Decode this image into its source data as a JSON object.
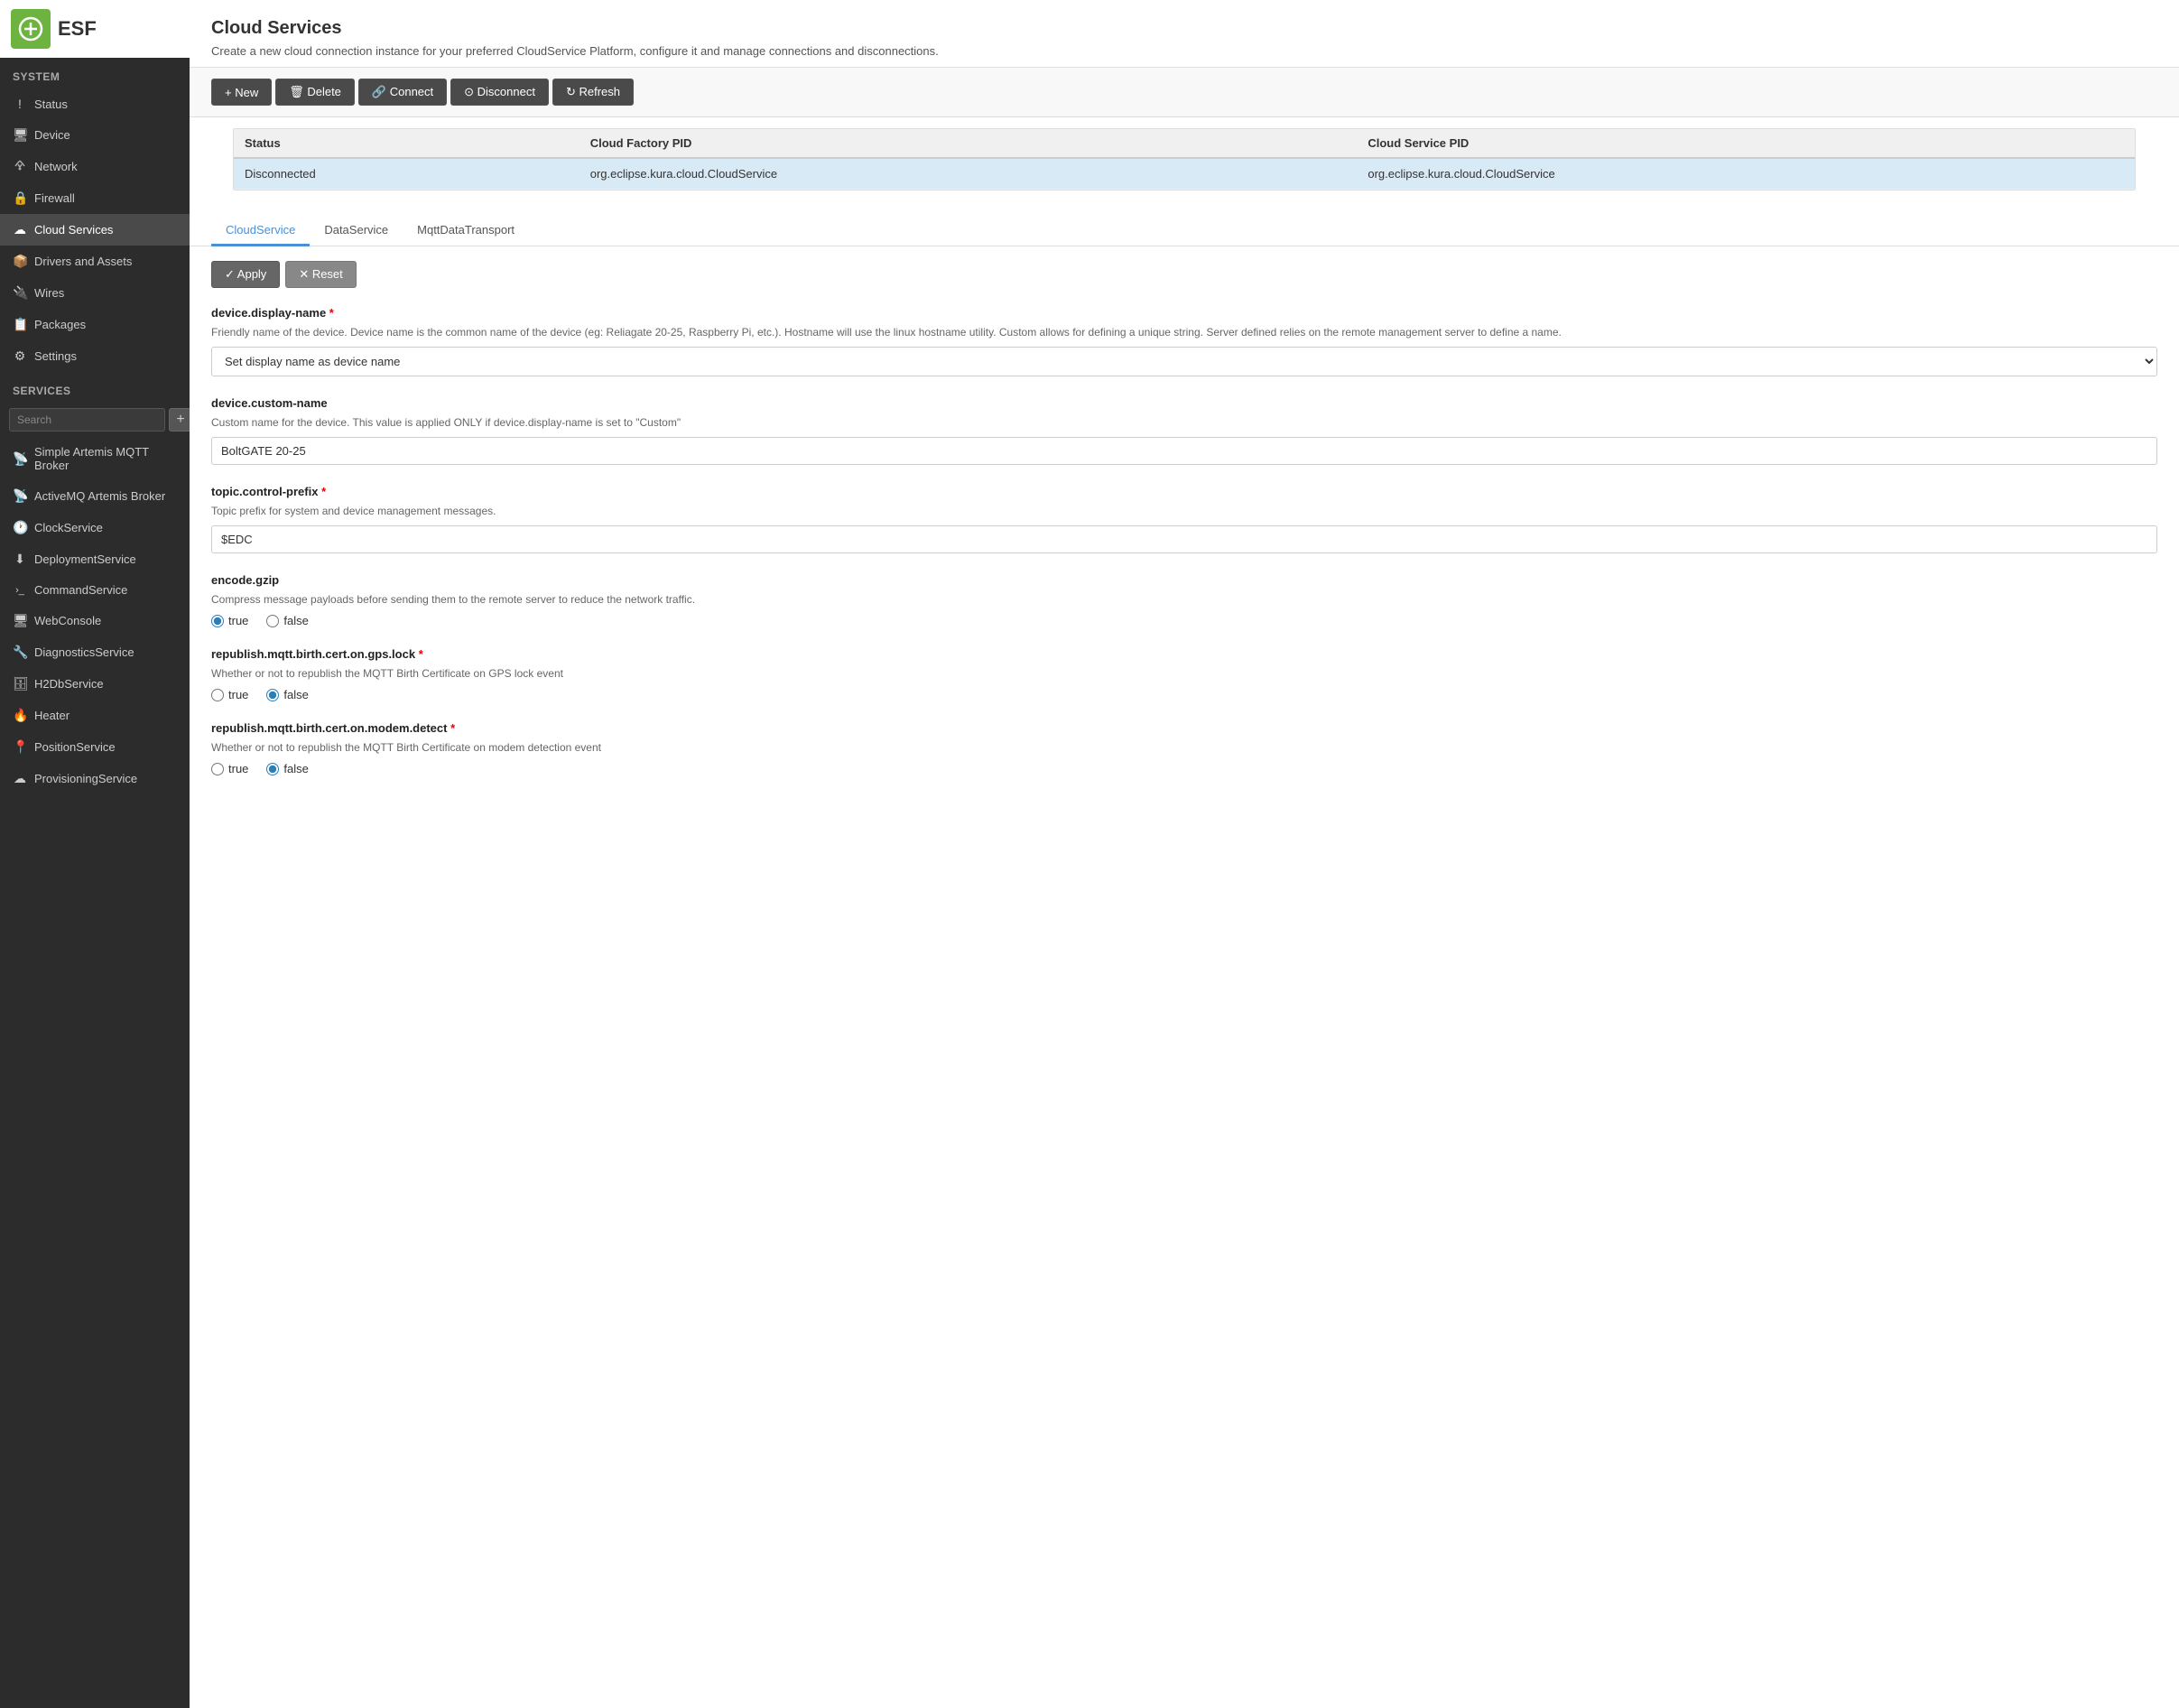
{
  "logo": {
    "text": "ESF"
  },
  "sidebar": {
    "system_section": "System",
    "system_items": [
      {
        "id": "status",
        "label": "Status",
        "icon": "!"
      },
      {
        "id": "device",
        "label": "Device",
        "icon": "🖥"
      },
      {
        "id": "network",
        "label": "Network",
        "icon": "📶"
      },
      {
        "id": "firewall",
        "label": "Firewall",
        "icon": "🔒"
      },
      {
        "id": "cloud-services",
        "label": "Cloud Services",
        "icon": "☁"
      },
      {
        "id": "drivers-assets",
        "label": "Drivers and Assets",
        "icon": "📦"
      },
      {
        "id": "wires",
        "label": "Wires",
        "icon": "🔌"
      },
      {
        "id": "packages",
        "label": "Packages",
        "icon": "📋"
      },
      {
        "id": "settings",
        "label": "Settings",
        "icon": "⚙"
      }
    ],
    "services_section": "Services",
    "services_search_placeholder": "Search",
    "services_add_label": "+",
    "services_items": [
      {
        "id": "simple-artemis",
        "label": "Simple Artemis MQTT Broker",
        "icon": "📡"
      },
      {
        "id": "activemq-artemis",
        "label": "ActiveMQ Artemis Broker",
        "icon": "📡"
      },
      {
        "id": "clockservice",
        "label": "ClockService",
        "icon": "🕐"
      },
      {
        "id": "deploymentservice",
        "label": "DeploymentService",
        "icon": "⬇"
      },
      {
        "id": "commandservice",
        "label": "CommandService",
        "icon": ">_"
      },
      {
        "id": "webconsole",
        "label": "WebConsole",
        "icon": "🖥"
      },
      {
        "id": "diagnosticsservice",
        "label": "DiagnosticsService",
        "icon": "🔧"
      },
      {
        "id": "h2dbservice",
        "label": "H2DbService",
        "icon": "🗄"
      },
      {
        "id": "heater",
        "label": "Heater",
        "icon": "🔥"
      },
      {
        "id": "positionservice",
        "label": "PositionService",
        "icon": "📍"
      },
      {
        "id": "provisioningservice",
        "label": "ProvisioningService",
        "icon": "☁"
      }
    ]
  },
  "page": {
    "title": "Cloud Services",
    "subtitle": "Create a new cloud connection instance for your preferred CloudService Platform, configure it and manage connections and disconnections."
  },
  "toolbar": {
    "new_label": "+ New",
    "delete_label": "🗑 Delete",
    "connect_label": "🔗 Connect",
    "disconnect_label": "⊙ Disconnect",
    "refresh_label": "↻ Refresh"
  },
  "table": {
    "columns": [
      "Status",
      "Cloud Factory PID",
      "Cloud Service PID"
    ],
    "rows": [
      {
        "status": "Disconnected",
        "factory_pid": "org.eclipse.kura.cloud.CloudService",
        "service_pid": "org.eclipse.kura.cloud.CloudService",
        "selected": true
      }
    ]
  },
  "tabs": [
    {
      "id": "cloudservice",
      "label": "CloudService",
      "active": true
    },
    {
      "id": "dataservice",
      "label": "DataService",
      "active": false
    },
    {
      "id": "mqttdatatransport",
      "label": "MqttDataTransport",
      "active": false
    }
  ],
  "config": {
    "apply_label": "✓ Apply",
    "reset_label": "✕ Reset",
    "fields": [
      {
        "id": "device-display-name",
        "label": "device.display-name",
        "required": true,
        "description": "Friendly name of the device. Device name is the common name of the device (eg: Reliagate 20-25, Raspberry Pi, etc.). Hostname will use the linux hostname utility. Custom allows for defining a unique string. Server defined relies on the remote management server to define a name.",
        "type": "select",
        "options": [
          "Set display name as device name"
        ],
        "value": "Set display name as device name"
      },
      {
        "id": "device-custom-name",
        "label": "device.custom-name",
        "required": false,
        "description": "Custom name for the device. This value is applied ONLY if device.display-name is set to \"Custom\"",
        "type": "text",
        "value": "BoltGATE 20-25"
      },
      {
        "id": "topic-control-prefix",
        "label": "topic.control-prefix",
        "required": true,
        "description": "Topic prefix for system and device management messages.",
        "type": "text",
        "value": "$EDC"
      },
      {
        "id": "encode-gzip",
        "label": "encode.gzip",
        "required": false,
        "description": "Compress message payloads before sending them to the remote server to reduce the network traffic.",
        "type": "radio",
        "options": [
          "true",
          "false"
        ],
        "value": "true"
      },
      {
        "id": "republish-mqtt-birth-cert-gps-lock",
        "label": "republish.mqtt.birth.cert.on.gps.lock",
        "required": true,
        "description": "Whether or not to republish the MQTT Birth Certificate on GPS lock event",
        "type": "radio",
        "options": [
          "true",
          "false"
        ],
        "value": "false"
      },
      {
        "id": "republish-mqtt-birth-cert-modem-detect",
        "label": "republish.mqtt.birth.cert.on.modem.detect",
        "required": true,
        "description": "Whether or not to republish the MQTT Birth Certificate on modem detection event",
        "type": "radio",
        "options": [
          "true",
          "false"
        ],
        "value": "false"
      }
    ]
  }
}
